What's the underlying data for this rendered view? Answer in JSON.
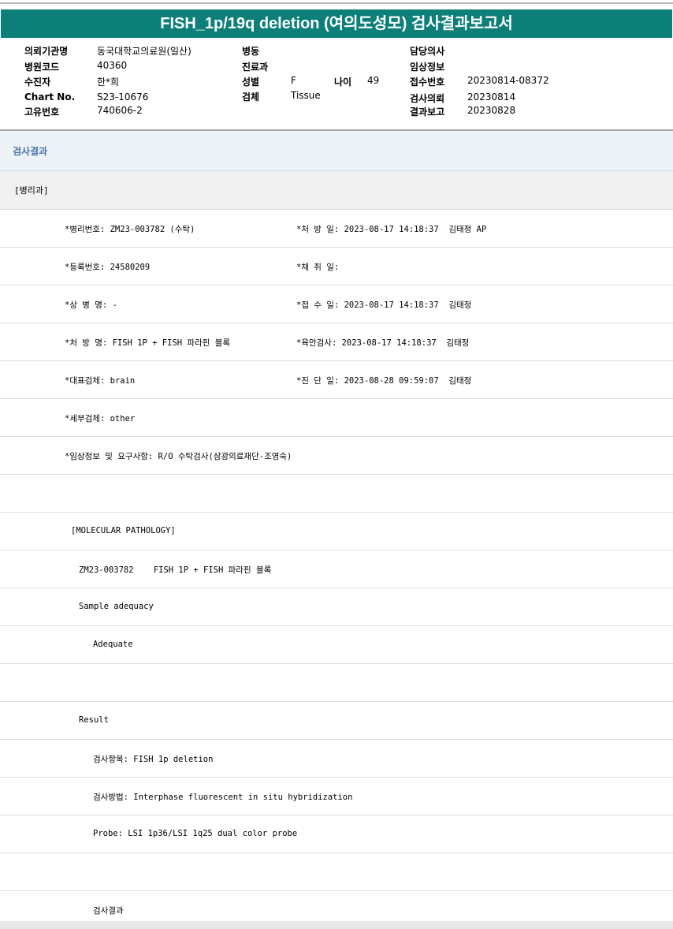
{
  "title": "FISH_1p/19q deletion (여의도성모) 검사결과보고서",
  "info": {
    "col1": [
      {
        "label": "의뢰기관명",
        "value": "동국대학교의료원(일산)"
      },
      {
        "label": "병원코드",
        "value": "40360"
      },
      {
        "label": "수진자",
        "value": "한*희"
      },
      {
        "label": "Chart No.",
        "value": "S23-10676"
      },
      {
        "label": "고유번호",
        "value": "740606-2"
      }
    ],
    "col2": [
      {
        "label": "병동",
        "value": ""
      },
      {
        "label": "진료과",
        "value": ""
      },
      {
        "label": "성별",
        "value": "F"
      },
      {
        "label": "검체",
        "value": "Tissue"
      }
    ],
    "age": {
      "label": "나이",
      "value": "49"
    },
    "col3": [
      {
        "label": "담당의사",
        "value": ""
      },
      {
        "label": "임상정보",
        "value": ""
      },
      {
        "label": "접수번호",
        "value": "20230814-08372"
      },
      {
        "label": "검사의뢰",
        "value": "20230814"
      },
      {
        "label": "결과보고",
        "value": "20230828"
      }
    ]
  },
  "section_title": "검사결과",
  "department": "[병리과]",
  "rows": [
    {
      "left": "*병리번호: ZM23-003782 (수탁)",
      "right": "*처 방 일: 2023-08-17 14:18:37  김태정 AP"
    },
    {
      "left": "*등록번호: 24580209",
      "right": "*채 취 일:"
    },
    {
      "left": "*상 병 명: -",
      "right": "*접 수 일: 2023-08-17 14:18:37  김태정"
    },
    {
      "left": "*처 방 명: FISH 1P + FISH 파라핀 블록",
      "right": "*육안검사: 2023-08-17 14:18:37  김태정"
    },
    {
      "left": "*대표검체: brain",
      "right": "*진 단 일: 2023-08-28 09:59:07  김태정"
    },
    {
      "left": "*세부검체: other",
      "right": ""
    },
    {
      "left": "*임상정보 및 요구사항: R/O 수탁검사(삼광의료재단-조영숙)",
      "right": ""
    },
    {
      "left": "",
      "right": ""
    },
    {
      "left": "[MOLECULAR PATHOLOGY]",
      "right": ""
    },
    {
      "left": "ZM23-003782    FISH 1P + FISH 파라핀 블록",
      "right": ""
    },
    {
      "left": "Sample adequacy",
      "right": ""
    },
    {
      "left": "Adequate",
      "right": ""
    },
    {
      "left": "",
      "right": ""
    },
    {
      "left": "Result",
      "right": ""
    },
    {
      "left": "검사항목: FISH 1p deletion",
      "right": ""
    },
    {
      "left": "검사방법: Interphase fluorescent in situ hybridization",
      "right": ""
    },
    {
      "left": "Probe: LSI 1p36/LSI 1q25 dual color probe",
      "right": ""
    },
    {
      "left": "",
      "right": ""
    },
    {
      "left": "검사결과",
      "right": ""
    }
  ]
}
